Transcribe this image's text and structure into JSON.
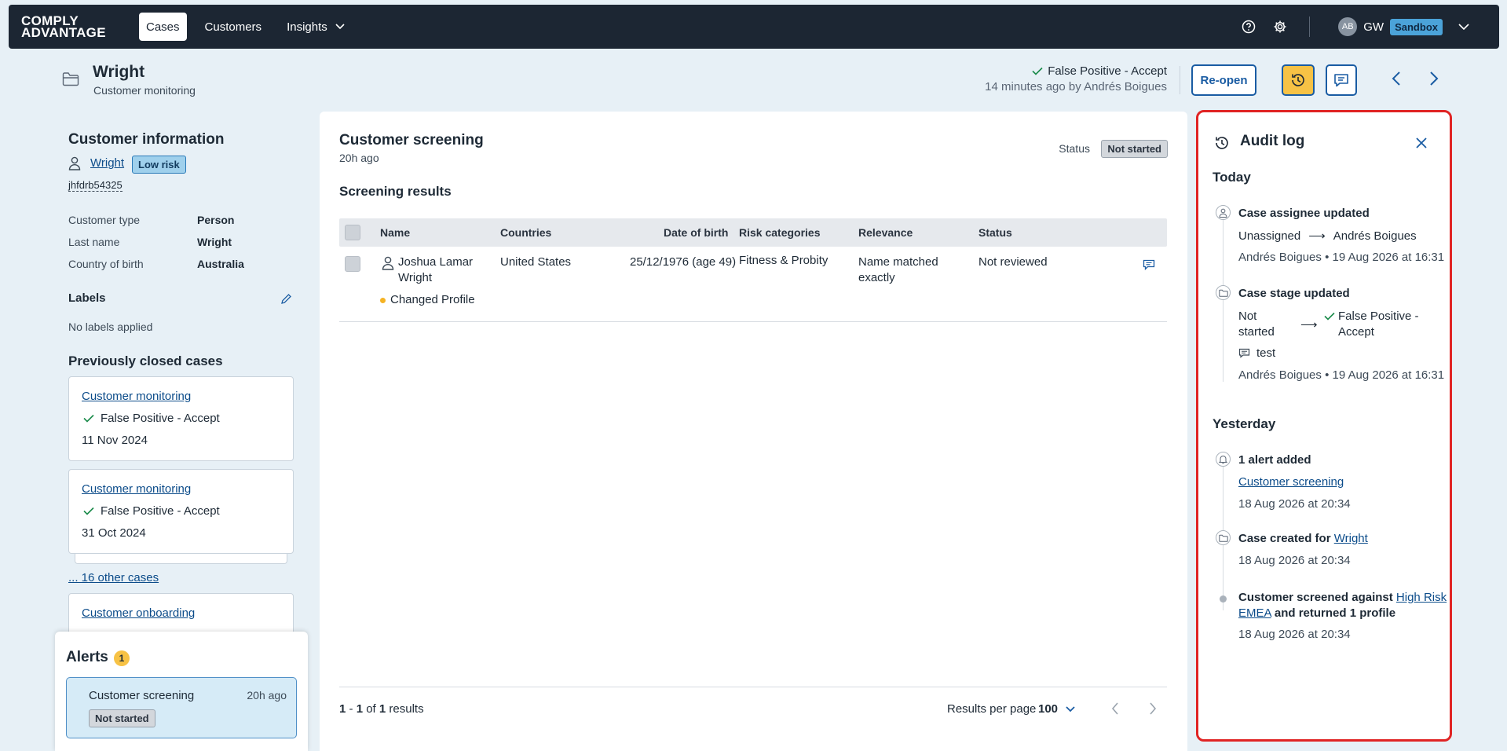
{
  "nav": {
    "logo_line1": "COMPLY",
    "logo_line2": "ADVANTAGE",
    "tabs": [
      {
        "label": "Cases",
        "active": true
      },
      {
        "label": "Customers",
        "active": false
      },
      {
        "label": "Insights",
        "active": false
      }
    ],
    "avatar_initials": "AB",
    "user_initials": "GW",
    "environment": "Sandbox"
  },
  "header": {
    "title": "Wright",
    "subtitle": "Customer monitoring",
    "stage": "False Positive - Accept",
    "stage_meta": "14 minutes ago by Andrés Boigues",
    "reopen_label": "Re-open"
  },
  "customer": {
    "section_title": "Customer information",
    "name": "Wright",
    "risk": "Low risk",
    "id": "jhfdrb54325",
    "fields": [
      {
        "label": "Customer type",
        "value": "Person"
      },
      {
        "label": "Last name",
        "value": "Wright"
      },
      {
        "label": "Country of birth",
        "value": "Australia"
      }
    ],
    "labels_title": "Labels",
    "labels_empty": "No labels applied"
  },
  "previous": {
    "title": "Previously closed cases",
    "cases": [
      {
        "type": "Customer monitoring",
        "stage": "False Positive - Accept",
        "date": "11 Nov 2024"
      },
      {
        "type": "Customer monitoring",
        "stage": "False Positive - Accept",
        "date": "31 Oct 2024"
      }
    ],
    "more_link": "... 16 other cases",
    "onboarding": "Customer onboarding"
  },
  "alerts": {
    "title": "Alerts",
    "count": "1",
    "items": [
      {
        "title": "Customer screening",
        "time": "20h ago",
        "status": "Not started"
      }
    ]
  },
  "screening": {
    "title": "Customer screening",
    "time": "20h ago",
    "status_label": "Status",
    "status": "Not started",
    "results_title": "Screening results",
    "columns": [
      "Name",
      "Countries",
      "Date of birth",
      "Risk categories",
      "Relevance",
      "Status"
    ],
    "rows": [
      {
        "name_line1": "Joshua Lamar",
        "name_line2": "Wright",
        "country": "United States",
        "dob": "25/12/1976 (age 49)",
        "risk": "Fitness & Probity",
        "relevance_line1": "Name matched",
        "relevance_line2": "exactly",
        "status": "Not reviewed",
        "tag": "Changed Profile"
      }
    ],
    "pagination": {
      "from": "1",
      "to": "1",
      "of_word": "of",
      "total": "1",
      "results_word": "results"
    },
    "per_page_label": "Results per page",
    "per_page_value": "100"
  },
  "audit": {
    "title": "Audit log",
    "today": "Today",
    "yesterday": "Yesterday",
    "e1": {
      "title": "Case assignee updated",
      "from": "Unassigned",
      "to": "Andrés Boigues",
      "meta": "Andrés Boigues • 19 Aug 2026 at 16:31"
    },
    "e2": {
      "title": "Case stage updated",
      "from1": "Not",
      "from2": "started",
      "to1": "False Positive -",
      "to2": "Accept",
      "comment": "test",
      "meta": "Andrés Boigues • 19 Aug 2026 at 16:31"
    },
    "e3": {
      "title": "1 alert added",
      "link": "Customer screening",
      "meta": "18 Aug 2026 at 20:34"
    },
    "e4": {
      "title": "Case created for",
      "link": "Wright",
      "meta": "18 Aug 2026 at 20:34"
    },
    "e5": {
      "pre": "Customer screened against",
      "link1": "High Risk",
      "link2": "EMEA",
      "post": "and returned 1 profile",
      "meta": "18 Aug 2026 at 20:34"
    }
  },
  "colors": {
    "accent": "#1a5ca3",
    "nav_bg": "#1c2633",
    "highlight": "#f7c245",
    "audit_border": "#e02424"
  }
}
